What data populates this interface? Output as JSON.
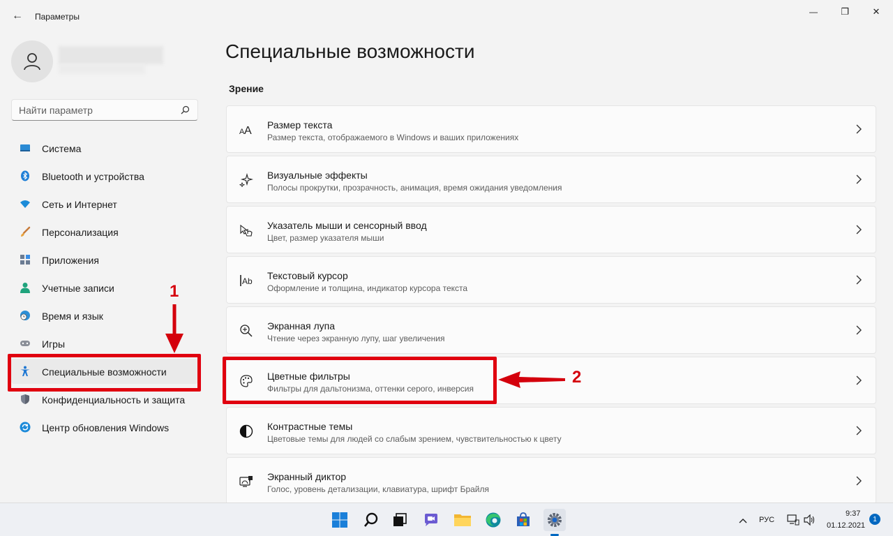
{
  "window": {
    "title": "Параметры",
    "back_glyph": "←",
    "minimize_glyph": "—",
    "maximize_glyph": "❐",
    "close_glyph": "✕"
  },
  "search": {
    "placeholder": "Найти параметр"
  },
  "sidebar": {
    "items": [
      {
        "label": "Система",
        "icon": "system-icon",
        "active": false
      },
      {
        "label": "Bluetooth и устройства",
        "icon": "bluetooth-icon",
        "active": false
      },
      {
        "label": "Сеть и Интернет",
        "icon": "wifi-icon",
        "active": false
      },
      {
        "label": "Персонализация",
        "icon": "brush-icon",
        "active": false
      },
      {
        "label": "Приложения",
        "icon": "apps-icon",
        "active": false
      },
      {
        "label": "Учетные записи",
        "icon": "account-icon",
        "active": false
      },
      {
        "label": "Время и язык",
        "icon": "clock-globe-icon",
        "active": false
      },
      {
        "label": "Игры",
        "icon": "gamepad-icon",
        "active": false
      },
      {
        "label": "Специальные возможности",
        "icon": "accessibility-icon",
        "active": true
      },
      {
        "label": "Конфиденциальность и защита",
        "icon": "shield-icon",
        "active": false
      },
      {
        "label": "Центр обновления Windows",
        "icon": "update-icon",
        "active": false
      }
    ]
  },
  "main": {
    "title": "Специальные возможности",
    "section": "Зрение",
    "cards": [
      {
        "title": "Размер текста",
        "desc": "Размер текста, отображаемого в Windows и ваших приложениях",
        "icon": "text-size-icon"
      },
      {
        "title": "Визуальные эффекты",
        "desc": "Полосы прокрутки, прозрачность, анимация, время ожидания уведомления",
        "icon": "sparkle-icon"
      },
      {
        "title": "Указатель мыши и сенсорный ввод",
        "desc": "Цвет, размер указателя мыши",
        "icon": "pointer-touch-icon"
      },
      {
        "title": "Текстовый курсор",
        "desc": "Оформление и толщина, индикатор курсора текста",
        "icon": "text-cursor-icon"
      },
      {
        "title": "Экранная лупа",
        "desc": "Чтение через экранную лупу, шаг увеличения",
        "icon": "magnifier-icon"
      },
      {
        "title": "Цветные фильтры",
        "desc": "Фильтры для дальтонизма, оттенки серого, инверсия",
        "icon": "palette-icon"
      },
      {
        "title": "Контрастные темы",
        "desc": "Цветовые темы для людей со слабым зрением, чувствительностью к цвету",
        "icon": "contrast-icon"
      },
      {
        "title": "Экранный диктор",
        "desc": "Голос, уровень детализации, клавиатура, шрифт Брайля",
        "icon": "narrator-icon"
      }
    ]
  },
  "annotations": {
    "marker1": "1",
    "marker2": "2",
    "color": "#e0000f"
  },
  "taskbar": {
    "tray": {
      "lang": "РУС",
      "time": "9:37",
      "date": "01.12.2021",
      "notifications": "1"
    },
    "icons": [
      "windows-start-icon",
      "search-icon",
      "task-view-icon",
      "teams-chat-icon",
      "file-explorer-icon",
      "edge-icon",
      "store-icon",
      "settings-icon"
    ]
  }
}
